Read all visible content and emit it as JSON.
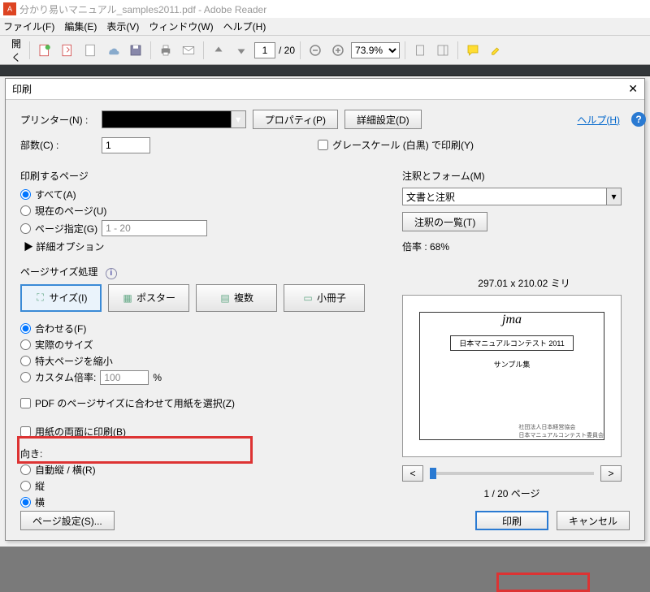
{
  "titlebar": {
    "filename": "分かり易いマニュアル_samples2011.pdf - Adobe Reader"
  },
  "menu": {
    "file": "ファイル(F)",
    "edit": "編集(E)",
    "view": "表示(V)",
    "window": "ウィンドウ(W)",
    "help": "ヘルプ(H)"
  },
  "toolbar": {
    "open": "開く",
    "page_value": "1",
    "page_total": "/ 20",
    "zoom": "73.9%"
  },
  "dialog": {
    "title": "印刷",
    "printer_label": "プリンター(N) :",
    "copies_label": "部数(C) :",
    "copies_value": "1",
    "properties_btn": "プロパティ(P)",
    "advanced_btn": "詳細設定(D)",
    "grayscale": "グレースケール (白黒) で印刷(Y)",
    "help_link": "ヘルプ(H)",
    "pages_section": "印刷するページ",
    "radio_all": "すべて(A)",
    "radio_current": "現在のページ(U)",
    "radio_range": "ページ指定(G)",
    "range_hint": "1 - 20",
    "adv_options": "▶ 詳細オプション",
    "size_section": "ページサイズ処理",
    "tab_size": "サイズ(I)",
    "tab_poster": "ポスター",
    "tab_multi": "複数",
    "tab_booklet": "小冊子",
    "fit": "合わせる(F)",
    "actual": "実際のサイズ",
    "shrink": "特大ページを縮小",
    "custom": "カスタム倍率:",
    "custom_value": "100",
    "choose_paper": "PDF のページサイズに合わせて用紙を選択(Z)",
    "duplex": "用紙の両面に印刷(B)",
    "orient_label": "向き:",
    "orient_auto": "自動縦 / 横(R)",
    "orient_portrait": "縦",
    "orient_landscape": "横",
    "comments_section": "注釈とフォーム(M)",
    "comments_value": "文書と注釈",
    "summarize_btn": "注釈の一覧(T)",
    "scale_label": "倍率 :  68%",
    "paper_size": "297.01 x 210.02 ミリ",
    "preview_title": "日本マニュアルコンテスト 2011",
    "preview_sub": "サンプル集",
    "page_info": "1 / 20 ページ",
    "page_setup_btn": "ページ設定(S)...",
    "print_btn": "印刷",
    "cancel_btn": "キャンセル"
  }
}
